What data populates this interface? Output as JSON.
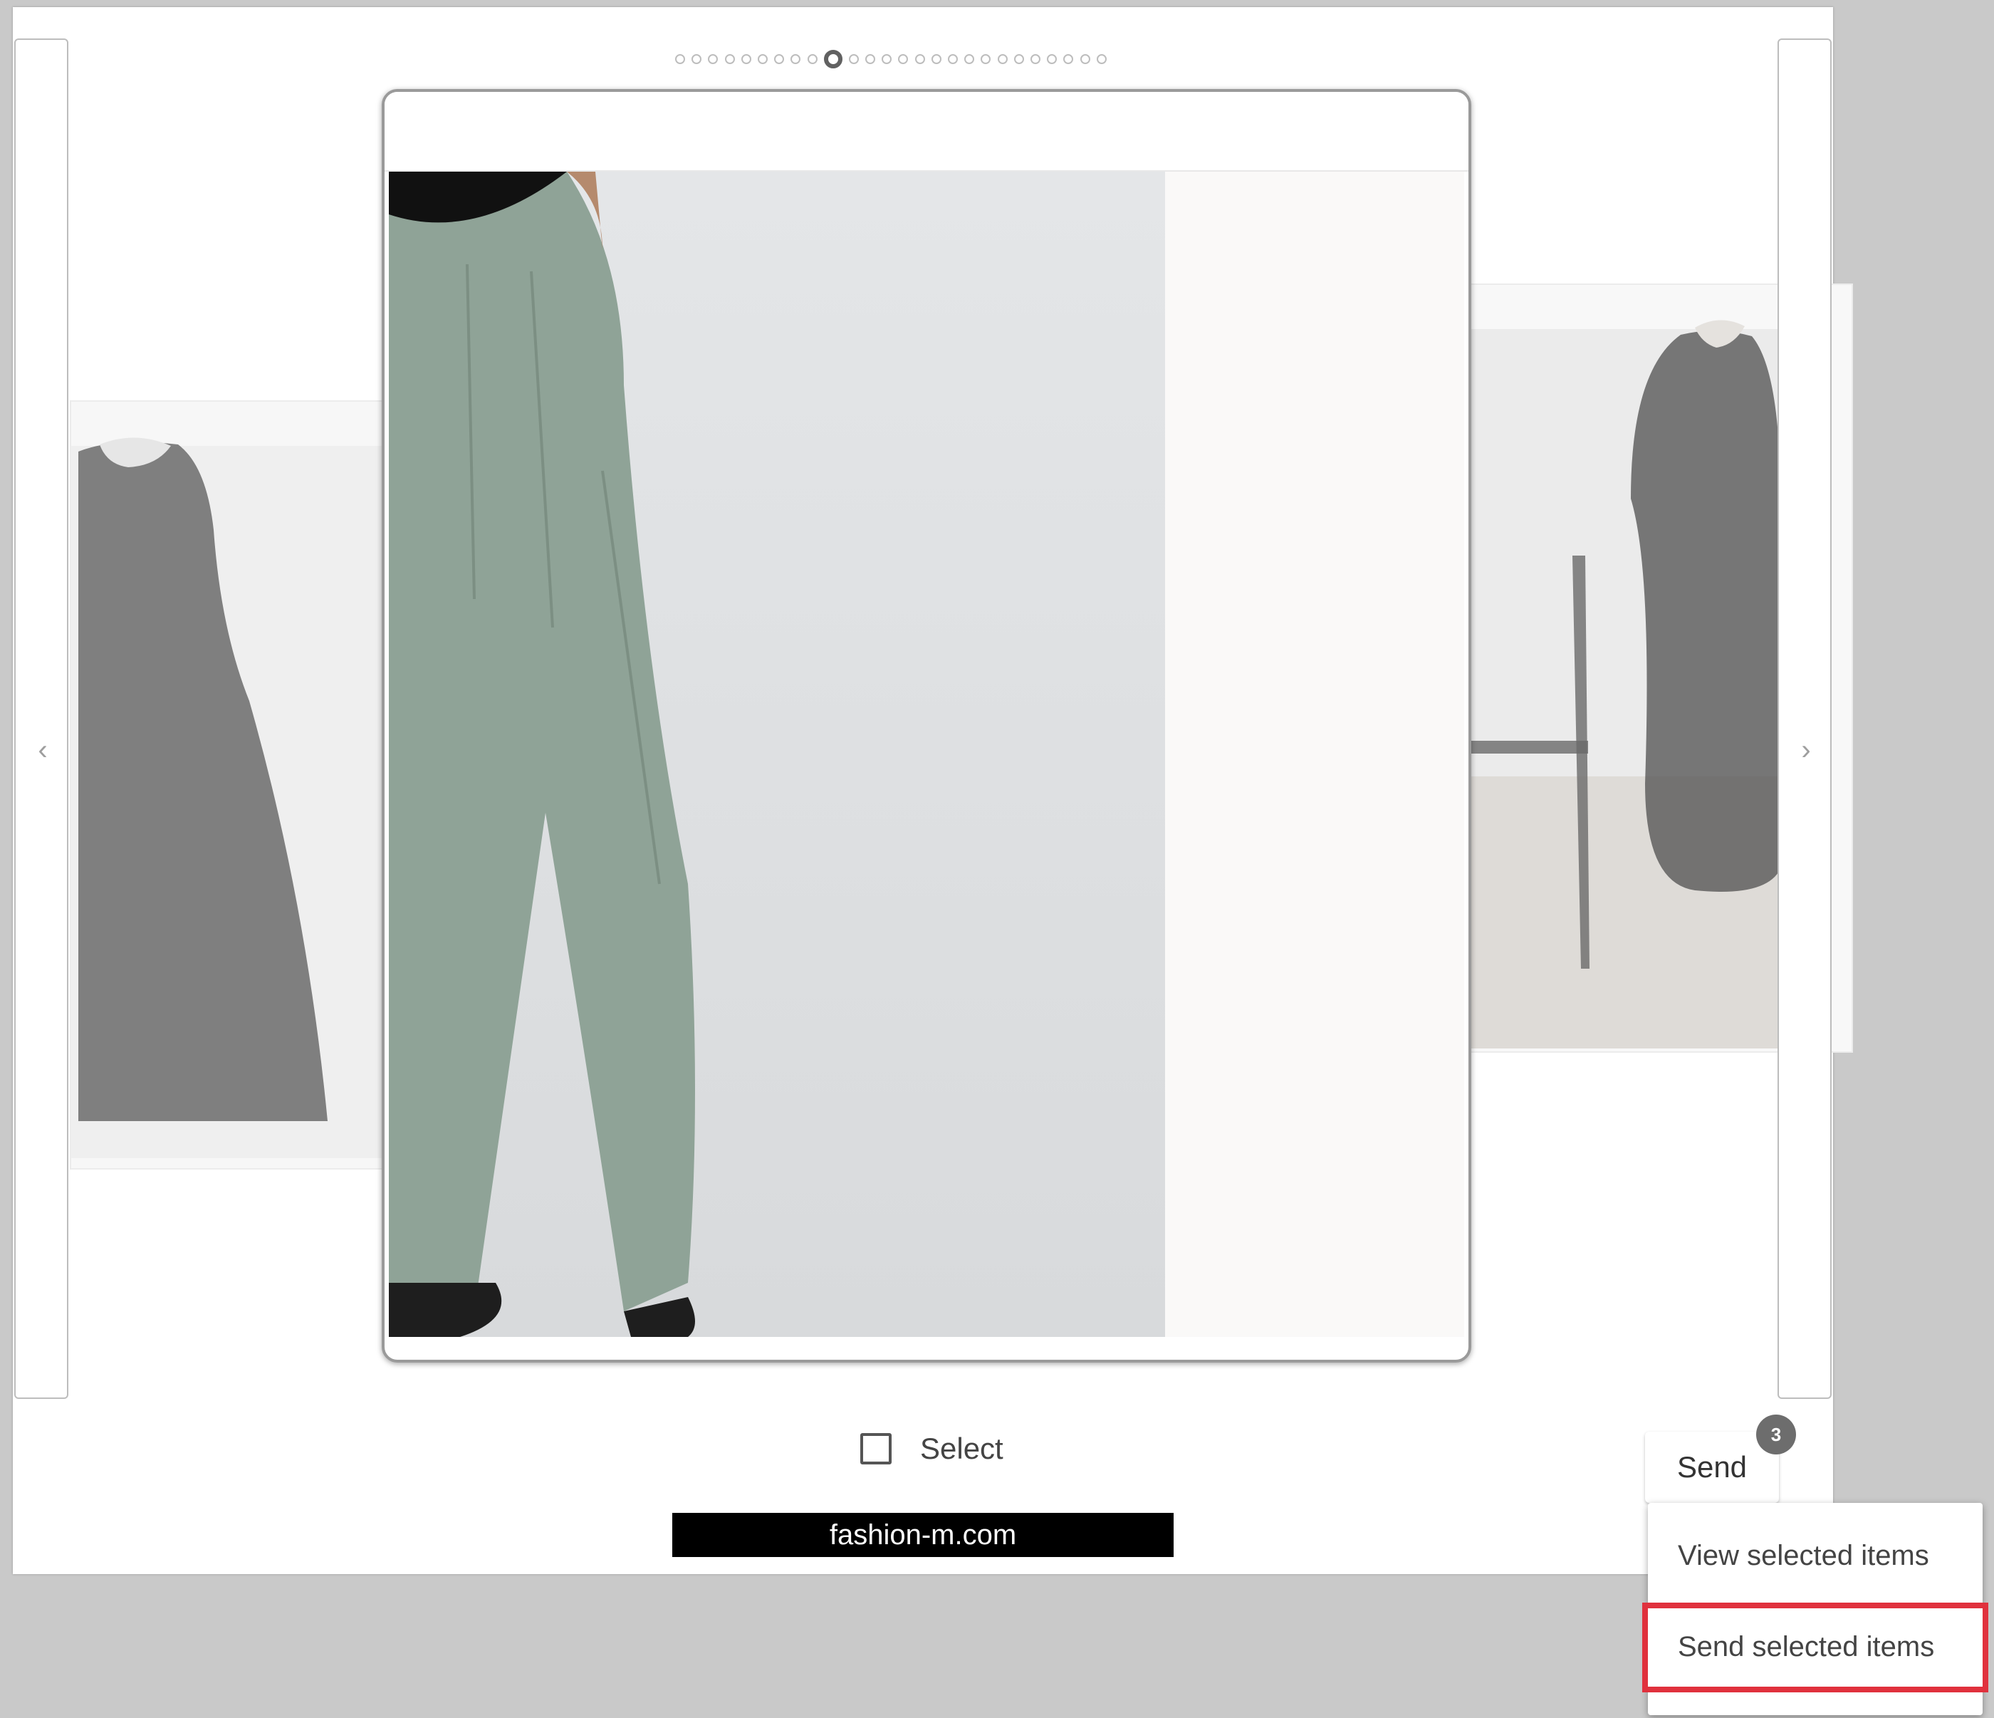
{
  "carousel": {
    "dot_count": 26,
    "active_index": 9,
    "prev_icon": "chevron-left-icon",
    "next_icon": "chevron-right-icon"
  },
  "select": {
    "label": "Select",
    "checked": false
  },
  "brand": {
    "text": "fashion-m.com"
  },
  "send": {
    "label": "Send",
    "badge_count": "3"
  },
  "menu": {
    "items": [
      {
        "label": "View selected items"
      },
      {
        "label": "Send selected items"
      }
    ]
  },
  "colors": {
    "highlight": "#e0313d",
    "badge": "#6d6d6d",
    "pants": "#8fa397"
  }
}
